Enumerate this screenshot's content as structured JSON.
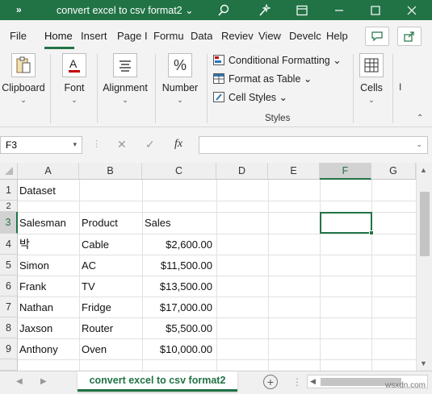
{
  "titlebar": {
    "chevrons": "»",
    "filename": "convert excel to csv format2 ⌄"
  },
  "tabs": [
    {
      "label": "File"
    },
    {
      "label": "Home"
    },
    {
      "label": "Insert"
    },
    {
      "label": "Page I"
    },
    {
      "label": "Formu"
    },
    {
      "label": "Data"
    },
    {
      "label": "Reviev"
    },
    {
      "label": "View"
    },
    {
      "label": "Develc"
    },
    {
      "label": "Help"
    }
  ],
  "ribbon": {
    "clipboard": "Clipboard",
    "font": "Font",
    "alignment": "Alignment",
    "number": "Number",
    "conditional_formatting": "Conditional Formatting ⌄",
    "format_as_table": "Format as Table ⌄",
    "cell_styles": "Cell Styles ⌄",
    "styles_group": "Styles",
    "cells": "Cells",
    "more": "I"
  },
  "formula_bar": {
    "name_box": "F3",
    "fx": "fx",
    "formula_value": ""
  },
  "columns": [
    "A",
    "B",
    "C",
    "D",
    "E",
    "F",
    "G"
  ],
  "rows": [
    "1",
    "2",
    "3",
    "4",
    "5",
    "6",
    "7",
    "8",
    "9"
  ],
  "cells": {
    "a1": "Dataset",
    "a3": "Salesman",
    "b3": "Product",
    "c3": "Sales",
    "a4": "박",
    "b4": "Cable",
    "c4": "$2,600.00",
    "a5": "Simon",
    "b5": "AC",
    "c5": "$11,500.00",
    "a6": "Frank",
    "b6": "TV",
    "c6": "$13,500.00",
    "a7": "Nathan",
    "b7": "Fridge",
    "c7": "$17,000.00",
    "a8": "Jaxson",
    "b8": "Router",
    "c8": "$5,500.00",
    "a9": "Anthony",
    "b9": "Oven",
    "c9": "$10,000.00"
  },
  "sheet_tab": "convert excel to csv format2",
  "watermark": "wsxdn.com",
  "colors": {
    "accent": "#217346",
    "ribbon_bg": "#f3f3f3"
  }
}
